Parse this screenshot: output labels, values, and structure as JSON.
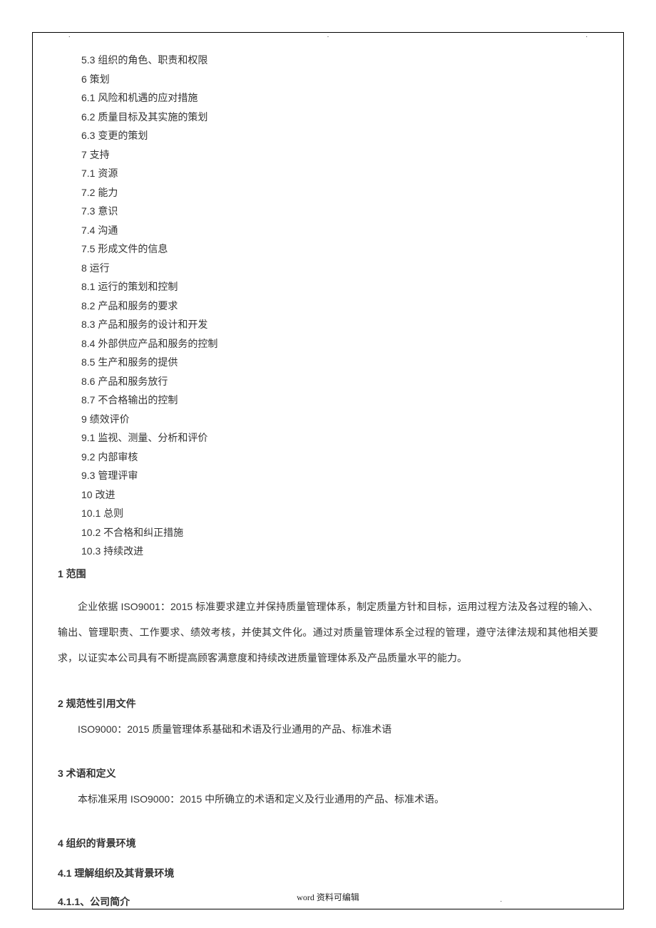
{
  "header_dots": [
    ".",
    ".",
    "."
  ],
  "toc": [
    "5.3  组织的角色、职责和权限",
    "6  策划",
    "6.1  风险和机遇的应对措施",
    "6.2  质量目标及其实施的策划",
    "6.3  变更的策划",
    "7  支持",
    "7.1  资源",
    "7.2  能力",
    "7.3  意识",
    "7.4  沟通",
    "7.5  形成文件的信息",
    "8  运行",
    "8.1  运行的策划和控制",
    "8.2  产品和服务的要求",
    "8.3  产品和服务的设计和开发",
    "8.4  外部供应产品和服务的控制",
    "8.5  生产和服务的提供",
    "8.6  产品和服务放行",
    "8.7  不合格输出的控制",
    "9  绩效评价",
    "9.1  监视、测量、分析和评价",
    "9.2  内部审核",
    "9.3  管理评审",
    "10  改进",
    "10.1  总则",
    "10.2  不合格和纠正措施",
    "10.3 持续改进"
  ],
  "sections": {
    "s1_heading": "1 范围",
    "s1_para": "企业依据 ISO9001：2015 标准要求建立并保持质量管理体系，制定质量方针和目标，运用过程方法及各过程的输入、输出、管理职责、工作要求、绩效考核，并使其文件化。通过对质量管理体系全过程的管理，遵守法律法规和其他相关要求，以证实本公司具有不断提高顾客满意度和持续改进质量管理体系及产品质量水平的能力。",
    "s2_heading": "2  规范性引用文件",
    "s2_para": "ISO9000：2015  质量管理体系基础和术语及行业通用的产品、标准术语",
    "s3_heading": "3  术语和定义",
    "s3_para": "本标准采用  ISO9000：2015  中所确立的术语和定义及行业通用的产品、标准术语。",
    "s4_heading": "4  组织的背景环境",
    "s41_heading": "4.1  理解组织及其背景环境",
    "s411_heading": "4.1.1、公司简介"
  },
  "footer": {
    "left": ".",
    "center": "word 资料可编辑",
    "right": "."
  }
}
